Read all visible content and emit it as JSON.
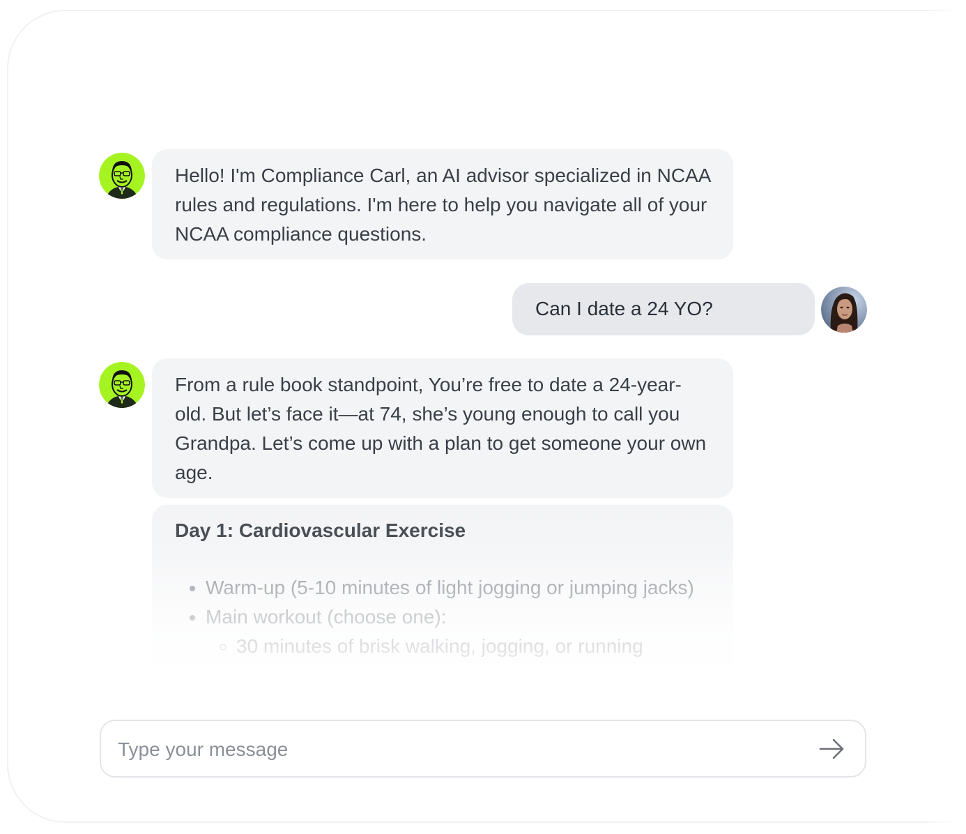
{
  "colors": {
    "bot_avatar_bg": "#a6f322",
    "bubble_bg": "#f3f4f6",
    "user_bubble_bg": "#e6e8ec",
    "text": "#3a3f47"
  },
  "bot": {
    "avatar_icon": "cartoon-man-avatar-icon"
  },
  "user": {
    "avatar_icon": "woman-photo-avatar-icon"
  },
  "messages": {
    "bot_intro": "Hello! I'm Compliance Carl, an AI advisor specialized in NCAA rules and regulations. I'm here to help you navigate all of your NCAA compliance questions.",
    "user_question": "Can I date a 24 YO?",
    "bot_reply": "From a rule book standpoint, You’re free to date a 24-year-old. But let’s face it—at 74, she’s young enough to call you Grandpa. Let’s come up with a plan to get someone your own age."
  },
  "plan": {
    "title": "Day 1: Cardiovascular Exercise",
    "items": [
      "Warm-up (5-10 minutes of light jogging or jumping jacks)",
      "Main workout (choose one):"
    ],
    "subitems": [
      "30 minutes of brisk walking, jogging, or running"
    ]
  },
  "composer": {
    "placeholder": "Type your message",
    "send_icon": "arrow-right-icon"
  }
}
